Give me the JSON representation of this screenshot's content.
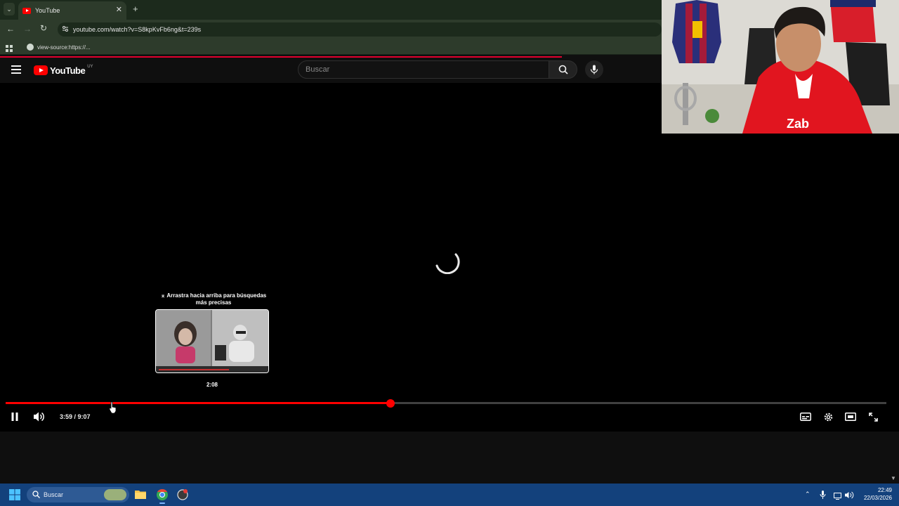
{
  "browser": {
    "tab_title": "YouTube",
    "url": "youtube.com/watch?v=S8kpKvFb6ng&t=239s",
    "bookmark_label": "view-source:https://...",
    "icons": [
      "tab-list-icon",
      "close-icon",
      "new-tab-icon",
      "back-icon",
      "forward-icon",
      "reload-icon",
      "site-info-icon",
      "apps-icon",
      "globe-icon"
    ]
  },
  "youtube": {
    "logo_text": "YouTube",
    "country_code": "UY",
    "search_placeholder": "Buscar"
  },
  "player": {
    "preview_hint": "⌅ Arrastra hacia arriba para búsquedas más precisas",
    "preview_time": "2:08",
    "time_display": "3:59 / 9:07",
    "progress_fraction": 0.437,
    "hover_fraction": 0.119,
    "accent_color": "#ff0000"
  },
  "taskbar": {
    "search_label": "Buscar",
    "clock_time": "22:49",
    "clock_date": "22/03/2026"
  }
}
